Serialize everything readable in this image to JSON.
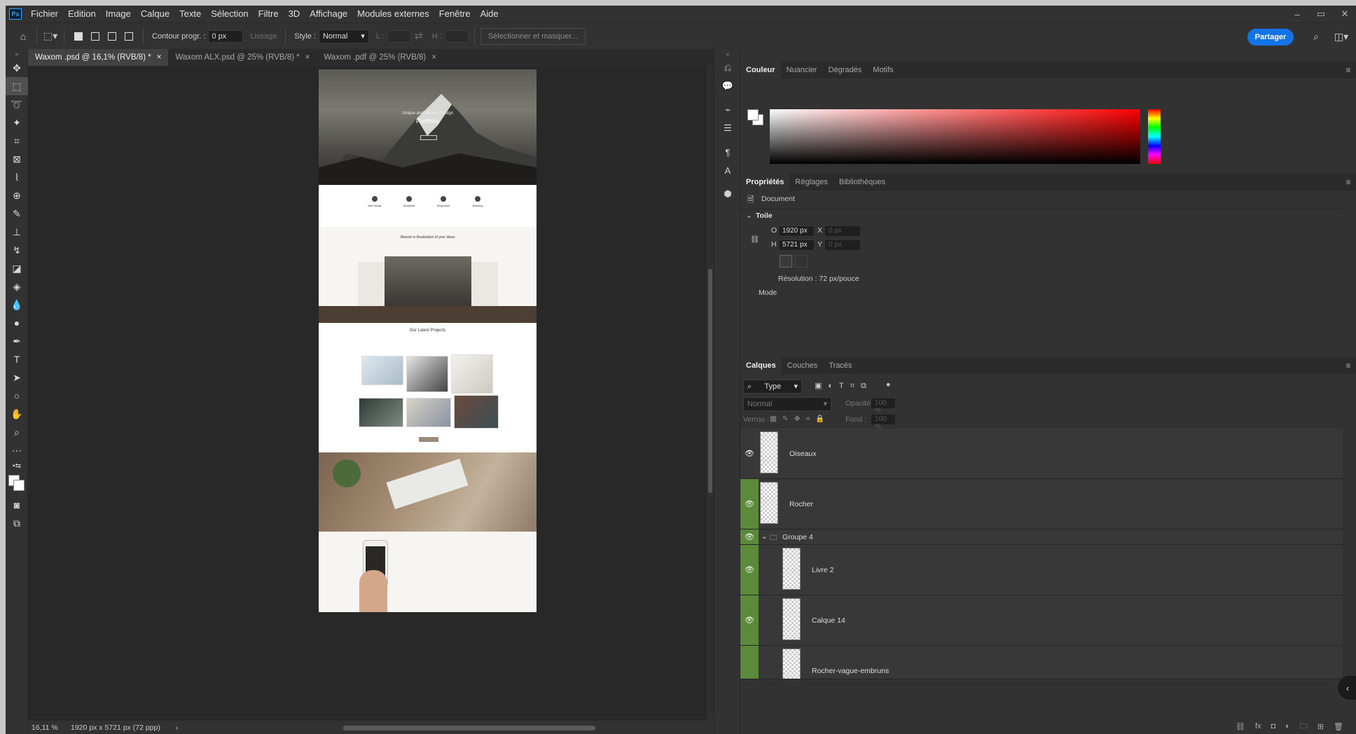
{
  "app": {
    "logo": "Ps"
  },
  "menu": [
    "Fichier",
    "Edition",
    "Image",
    "Calque",
    "Texte",
    "Sélection",
    "Filtre",
    "3D",
    "Affichage",
    "Modules externes",
    "Fenêtre",
    "Aide"
  ],
  "window_controls": [
    "–",
    "▭",
    "✕"
  ],
  "options": {
    "contour_label": "Contour progr. :",
    "contour_value": "0 px",
    "lissage_label": "Lissage",
    "style_label": "Style :",
    "style_value": "Normal",
    "l_label": "L :",
    "h_label": "H :",
    "select_mask_label": "Sélectionner et masquer...",
    "share_label": "Partager"
  },
  "tabs": [
    {
      "label": "Waxom .psd @ 16,1% (RVB/8) *"
    },
    {
      "label": "Waxom ALX.psd @ 25% (RVB/8) *"
    },
    {
      "label": "Waxom .pdf @ 25% (RVB/8)"
    }
  ],
  "status": {
    "zoom": "16,11 %",
    "doc_info": "1920 px x 5721 px (72 ppp)"
  },
  "canvas_doc": {
    "hero_title": "Unique and Modern Design",
    "hero_subtitle": "Portfolio",
    "welcome_title": "Waxom is Realization of your Ideas",
    "projects_title": "Our Latest Projects",
    "features": [
      "Web Design",
      "Wordpress",
      "Responsive",
      "Branding"
    ]
  },
  "color_panel": {
    "tabs": [
      "Couleur",
      "Nuancier",
      "Dégradés",
      "Motifs"
    ]
  },
  "props_panel": {
    "tabs": [
      "Propriétés",
      "Réglages",
      "Bibliothèques"
    ],
    "document_label": "Document",
    "toile_label": "Toile",
    "w_label": "O",
    "w_value": "1920 px",
    "x_label": "X",
    "x_value": "0 px",
    "h_label": "H",
    "h_value": "5721 px",
    "y_label": "Y",
    "y_value": "0 px",
    "resolution": "Résolution : 72 px/pouce",
    "mode_label": "Mode"
  },
  "layers_panel": {
    "tabs": [
      "Calques",
      "Couches",
      "Tracés"
    ],
    "filter_type": "Type",
    "blend_mode": "Normal",
    "opacity_label": "Opacité :",
    "opacity_value": "100 %",
    "lock_label": "Verrou :",
    "fill_label": "Fond :",
    "fill_value": "100 %",
    "layers": [
      {
        "name": "Oiseaux"
      },
      {
        "name": "Rocher"
      },
      {
        "name": "Groupe 4"
      },
      {
        "name": "Livre 2"
      },
      {
        "name": "Calque 14"
      },
      {
        "name": "Rocher-vague-embruns"
      }
    ]
  }
}
